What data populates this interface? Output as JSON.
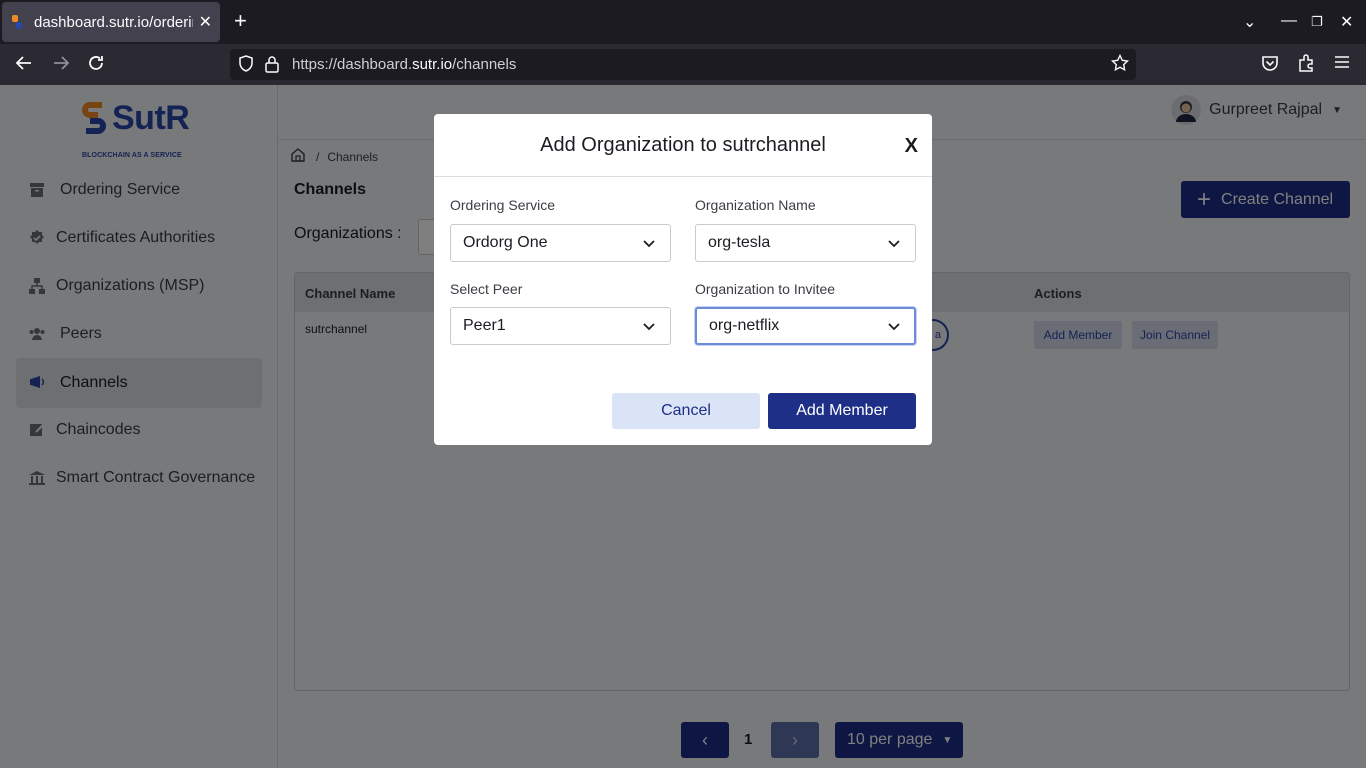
{
  "browser": {
    "tab_title": "dashboard.sutr.io/ordering",
    "url_prefix": "https://dashboard.",
    "url_domain": "sutr.io",
    "url_path": "/channels"
  },
  "brand": {
    "name": "SutR",
    "tagline": "BLOCKCHAIN AS A SERVICE",
    "color": "#2947a8",
    "accent": "#f08a24"
  },
  "sidebar": {
    "items": [
      {
        "label": "Ordering Service",
        "icon": "archive-icon"
      },
      {
        "label": "Certificates Authorities",
        "icon": "badge-check-icon"
      },
      {
        "label": "Organizations (MSP)",
        "icon": "sitemap-icon"
      },
      {
        "label": "Peers",
        "icon": "users-icon"
      },
      {
        "label": "Channels",
        "icon": "broadcast-icon"
      },
      {
        "label": "Chaincodes",
        "icon": "edit-icon"
      },
      {
        "label": "Smart Contract Governance",
        "icon": "bank-icon"
      }
    ]
  },
  "header": {
    "user_name": "Gurpreet Rajpal"
  },
  "breadcrumb": {
    "current": "Channels"
  },
  "main": {
    "title": "Channels",
    "create_label": "Create Channel",
    "org_label": "Organizations :",
    "table": {
      "col_channel": "Channel Name",
      "col_actions": "Actions",
      "row_channel": "sutrchannel",
      "row_pill": "a",
      "add_member": "Add Member",
      "join_channel": "Join Channel"
    },
    "pagination": {
      "page": "1",
      "per_page": "10 per page"
    }
  },
  "modal": {
    "title": "Add Organization to sutrchannel",
    "close": "X",
    "ordering_label": "Ordering Service",
    "ordering_value": "Ordorg One",
    "orgname_label": "Organization Name",
    "orgname_value": "org-tesla",
    "peer_label": "Select Peer",
    "peer_value": "Peer1",
    "invitee_label": "Organization to Invitee",
    "invitee_value": "org-netflix",
    "cancel": "Cancel",
    "submit": "Add Member"
  }
}
